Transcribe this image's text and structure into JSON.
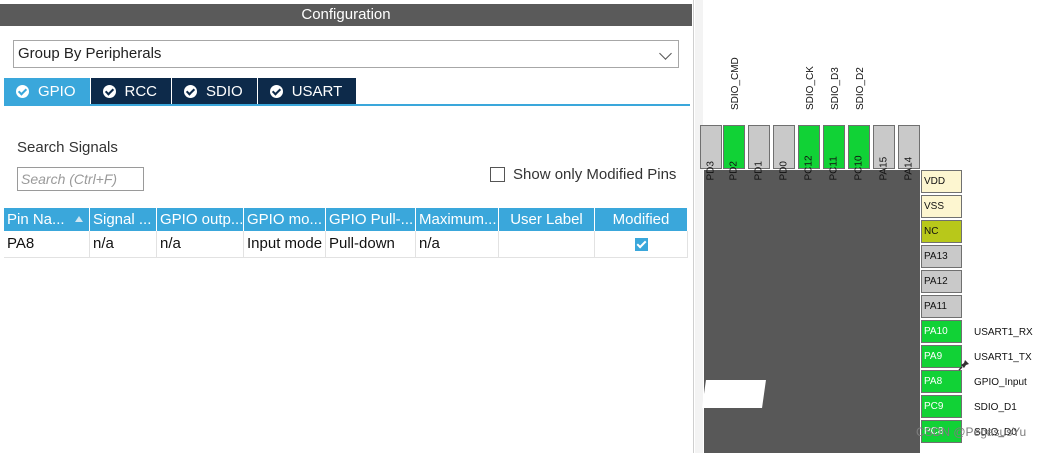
{
  "config": {
    "title": "Configuration",
    "group_by": "Group By Peripherals",
    "tabs": [
      {
        "label": "GPIO",
        "active": true
      },
      {
        "label": "RCC",
        "active": false
      },
      {
        "label": "SDIO",
        "active": false
      },
      {
        "label": "USART",
        "active": false
      }
    ],
    "search_label": "Search Signals",
    "search_placeholder": "Search (Ctrl+F)",
    "show_modified_label": "Show only Modified Pins",
    "show_modified_checked": false,
    "table": {
      "headers": [
        "Pin Na...",
        "Signal ...",
        "GPIO outp...",
        "GPIO mo...",
        "GPIO Pull-...",
        "Maximum...",
        "User Label",
        "Modified"
      ],
      "rows": [
        {
          "pin": "PA8",
          "signal": "n/a",
          "gpio_output": "n/a",
          "gpio_mode": "Input mode",
          "gpio_pull": "Pull-down",
          "maximum": "n/a",
          "user_label": "",
          "modified": true
        }
      ]
    }
  },
  "pinout": {
    "top_labels": [
      "SDIO_CMD",
      "SDIO_CK",
      "SDIO_D3",
      "SDIO_D2"
    ],
    "top_pins": [
      {
        "name": "PD3",
        "status": "default"
      },
      {
        "name": "PD2",
        "status": "assigned"
      },
      {
        "name": "PD1",
        "status": "default"
      },
      {
        "name": "PD0",
        "status": "default"
      },
      {
        "name": "PC12",
        "status": "assigned"
      },
      {
        "name": "PC11",
        "status": "assigned"
      },
      {
        "name": "PC10",
        "status": "assigned"
      },
      {
        "name": "PA15",
        "status": "default"
      },
      {
        "name": "PA14",
        "status": "default"
      }
    ],
    "right_pins": [
      {
        "name": "VDD",
        "status": "power",
        "label": ""
      },
      {
        "name": "VSS",
        "status": "power",
        "label": ""
      },
      {
        "name": "NC",
        "status": "nc",
        "label": ""
      },
      {
        "name": "PA13",
        "status": "default",
        "label": ""
      },
      {
        "name": "PA12",
        "status": "default",
        "label": ""
      },
      {
        "name": "PA11",
        "status": "default",
        "label": ""
      },
      {
        "name": "PA10",
        "status": "assigned",
        "label": "USART1_RX"
      },
      {
        "name": "PA9",
        "status": "assigned",
        "label": "USART1_TX"
      },
      {
        "name": "PA8",
        "status": "assigned",
        "label": "GPIO_Input"
      },
      {
        "name": "PC9",
        "status": "assigned",
        "label": "SDIO_D1"
      },
      {
        "name": "PC8",
        "status": "assigned",
        "label": "SDIO_D0"
      }
    ],
    "colors": {
      "assigned": "#11d236",
      "default": "#c9c9c9",
      "power": "#fdf6d0",
      "nc": "#b8c81a",
      "chip": "#585858",
      "accent": "#3aa7db",
      "tab_dark": "#0d2a4a"
    }
  },
  "watermark": "CSDN @PegasusYu"
}
